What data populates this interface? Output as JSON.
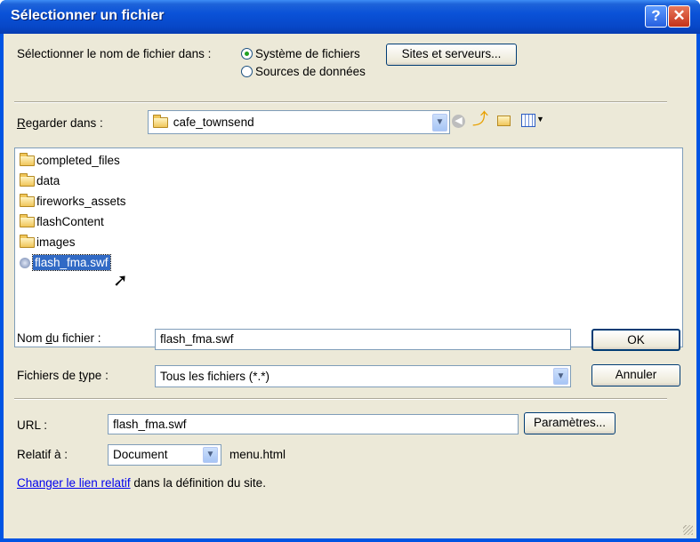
{
  "window": {
    "title": "Sélectionner un fichier",
    "help_glyph": "?",
    "close_glyph": "✕"
  },
  "source": {
    "label": "Sélectionner le nom de fichier dans :",
    "option_filesystem": "Système de fichiers",
    "option_datasource": "Sources de données",
    "sites_button": "Sites et serveurs..."
  },
  "look_in": {
    "label_underlined": "R",
    "label_rest": "egarder dans :",
    "value": "cafe_townsend"
  },
  "files": [
    {
      "name": "completed_files",
      "icon": "folder-icon"
    },
    {
      "name": "data",
      "icon": "folder-icon"
    },
    {
      "name": "fireworks_assets",
      "icon": "folder-icon"
    },
    {
      "name": "flashContent",
      "icon": "folder-icon"
    },
    {
      "name": "images",
      "icon": "folder-icon"
    },
    {
      "name": "flash_fma.swf",
      "icon": "swf-file-icon",
      "selected": true
    }
  ],
  "filename": {
    "label_pre": "Nom ",
    "label_underlined": "d",
    "label_post": "u fichier :",
    "value": "flash_fma.swf",
    "ok": "OK"
  },
  "filetype": {
    "label_pre": "Fichiers de ",
    "label_underlined": "t",
    "label_post": "ype :",
    "value": "Tous les fichiers (*.*)",
    "cancel": "Annuler"
  },
  "url": {
    "label": "URL :",
    "value": "flash_fma.swf",
    "params_button": "Paramètres..."
  },
  "relative": {
    "label": "Relatif à :",
    "value": "Document",
    "file": "menu.html"
  },
  "change_link": {
    "link": "Changer le lien relatif",
    "rest": "dans la définition  du site."
  },
  "colors": {
    "title_bar": "#0a52d8",
    "dialog_bg": "#ece9d8",
    "selection": "#316ac5"
  }
}
